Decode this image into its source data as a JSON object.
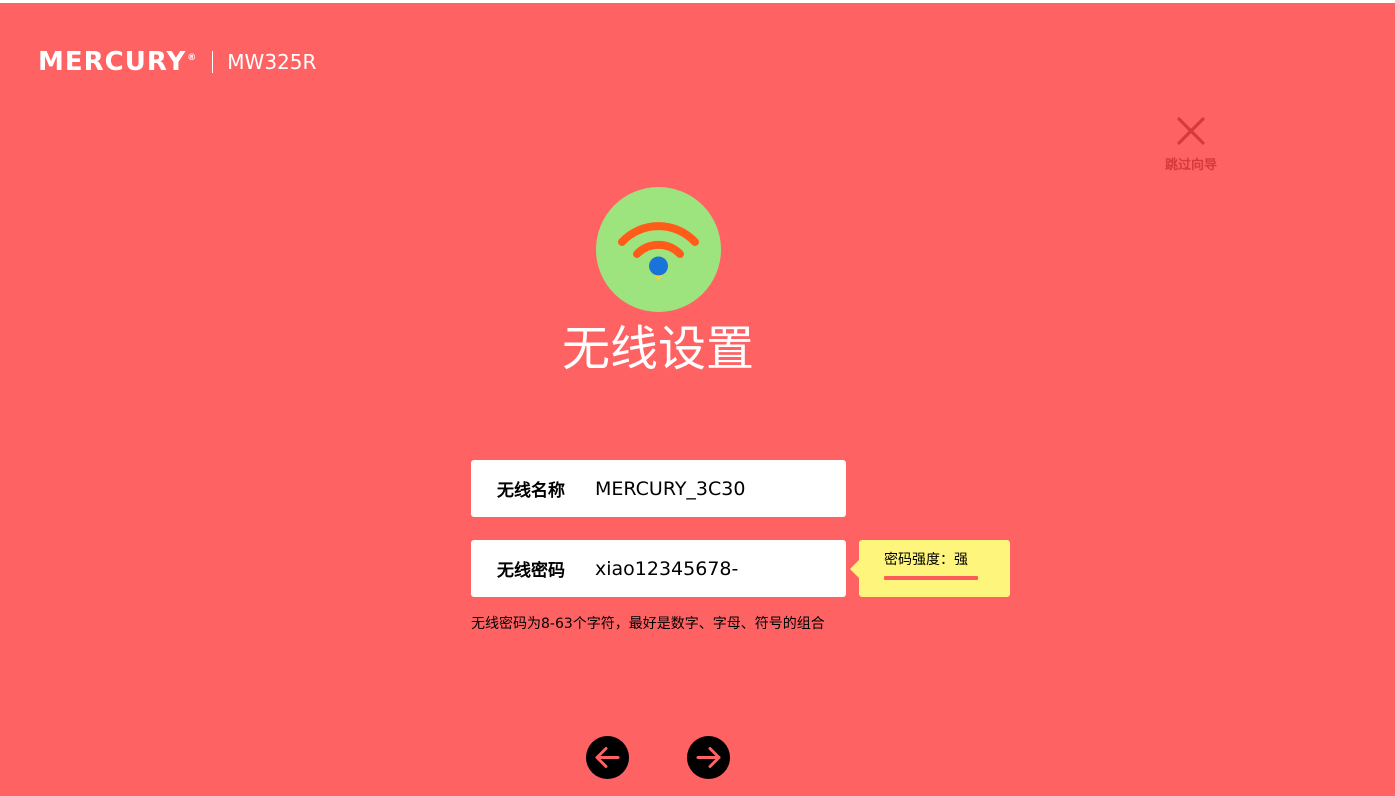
{
  "header": {
    "brand": "MERCURY",
    "model": "MW325R"
  },
  "skip": {
    "label": "跳过向导",
    "icon": "close-icon"
  },
  "main": {
    "icon": "wifi-icon",
    "title": "无线设置"
  },
  "form": {
    "ssid_label": "无线名称",
    "ssid_value": "MERCURY_3C30",
    "password_label": "无线密码",
    "password_value": "xiao12345678-",
    "hint": "无线密码为8-63个字符，最好是数字、字母、符号的组合"
  },
  "strength": {
    "text": "密码强度：强",
    "level": 1.0
  },
  "nav": {
    "prev_icon": "arrow-left-icon",
    "next_icon": "arrow-right-icon"
  },
  "colors": {
    "background": "#ff6262",
    "icon_circle": "#9de47f",
    "wifi_arcs": "#ff5c1a",
    "wifi_dot": "#1874d8",
    "tooltip": "#fef57c",
    "skip": "#d73a3a"
  }
}
